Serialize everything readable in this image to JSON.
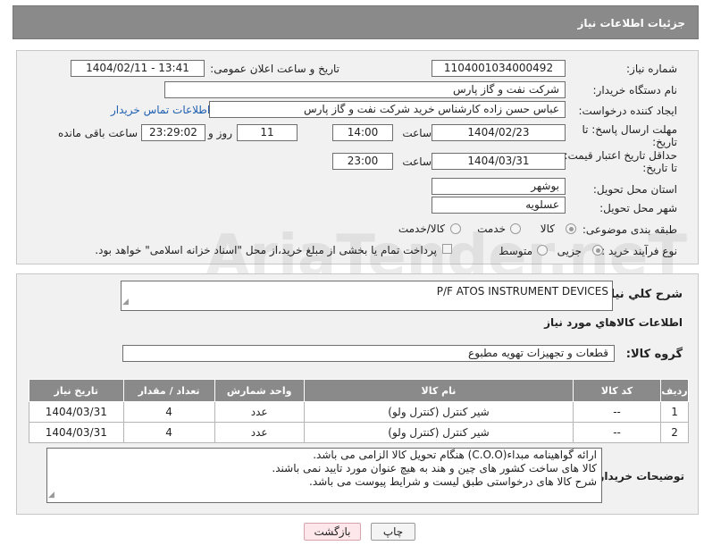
{
  "header": {
    "title": "جزئیات اطلاعات نیاز"
  },
  "form": {
    "need_number_label": "شماره نیاز:",
    "need_number": "1104001034000492",
    "announce_label": "تاریخ و ساعت اعلان عمومی:",
    "announce_value": "1404/02/11 - 13:41",
    "buyer_org_label": "نام دستگاه خریدار:",
    "buyer_org": "شرکت نفت و گاز پارس",
    "requester_label": "ایجاد کننده درخواست:",
    "requester": "عباس حسن زاده کارشناس خرید شرکت نفت و گاز پارس",
    "buyer_contact_link": "اطلاعات تماس خریدار",
    "reply_deadline_label_1": "مهلت ارسال پاسخ: تا",
    "reply_deadline_label_2": "تاریخ:",
    "reply_date": "1404/02/23",
    "time_label": "ساعت",
    "reply_time": "14:00",
    "days_value": "11",
    "days_label": "روز و",
    "remaining_value": "23:29:02",
    "remaining_label": "ساعت باقی مانده",
    "price_validity_label_1": "حداقل تاریخ اعتبار قیمت:",
    "price_validity_label_2": "تا تاریخ:",
    "validity_date": "1404/03/31",
    "validity_time": "23:00",
    "province_label": "استان محل تحویل:",
    "province": "بوشهر",
    "city_label": "شهر محل تحویل:",
    "city": "عسلویه",
    "category_label": "طبقه بندی موضوعی:",
    "category_options": [
      "کالا",
      "خدمت",
      "کالا/خدمت"
    ],
    "process_label": "نوع فرآیند خرید :",
    "process_options": [
      "جزیی",
      "متوسط"
    ],
    "payment_note": "پرداخت تمام یا بخشی از مبلغ خرید،از محل \"اسناد خزانه اسلامی\" خواهد بود."
  },
  "summary": {
    "label": "شرح کلي نياز:",
    "value": "P/F ATOS INSTRUMENT DEVICES"
  },
  "goods_section_title": "اطلاعات کالاهاي مورد نياز",
  "goods_group": {
    "label": "گروه کالا:",
    "value": "قطعات و تجهیزات تهویه مطبوع"
  },
  "table": {
    "headers": [
      "رديف",
      "کد کالا",
      "نام کالا",
      "واحد شمارش",
      "تعداد / مقدار",
      "تاريخ نياز"
    ],
    "rows": [
      [
        "1",
        "--",
        "شیر کنترل (کنترل ولو)",
        "عدد",
        "4",
        "1404/03/31"
      ],
      [
        "2",
        "--",
        "شیر کنترل (کنترل ولو)",
        "عدد",
        "4",
        "1404/03/31"
      ]
    ]
  },
  "buyer_notes": {
    "label": "توضیحات خریدار:",
    "lines": [
      "ارائه گواهینامه مبداء(C.O.O) هنگام تحویل کالا الزامی می باشد.",
      "کالا های ساخت کشور های چین و هند به هیچ عنوان مورد تایید نمی باشند.",
      "شرح کالا های درخواستی طبق لیست و شرایط پیوست می باشد."
    ]
  },
  "buttons": {
    "print": "چاپ",
    "back": "بازگشت"
  },
  "watermark": "AriaTender.neT"
}
